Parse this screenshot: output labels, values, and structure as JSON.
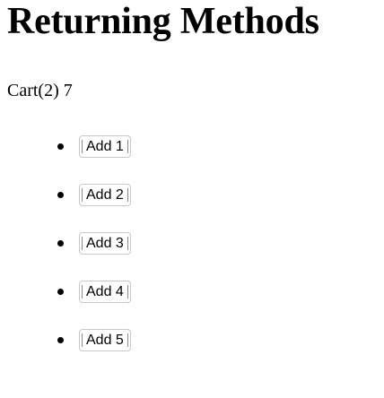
{
  "page": {
    "title": "Returning Methods",
    "cart_text": "Cart(2) 7"
  },
  "items": [
    {
      "label": "Add 1"
    },
    {
      "label": "Add 2"
    },
    {
      "label": "Add 3"
    },
    {
      "label": "Add 4"
    },
    {
      "label": "Add 5"
    }
  ]
}
